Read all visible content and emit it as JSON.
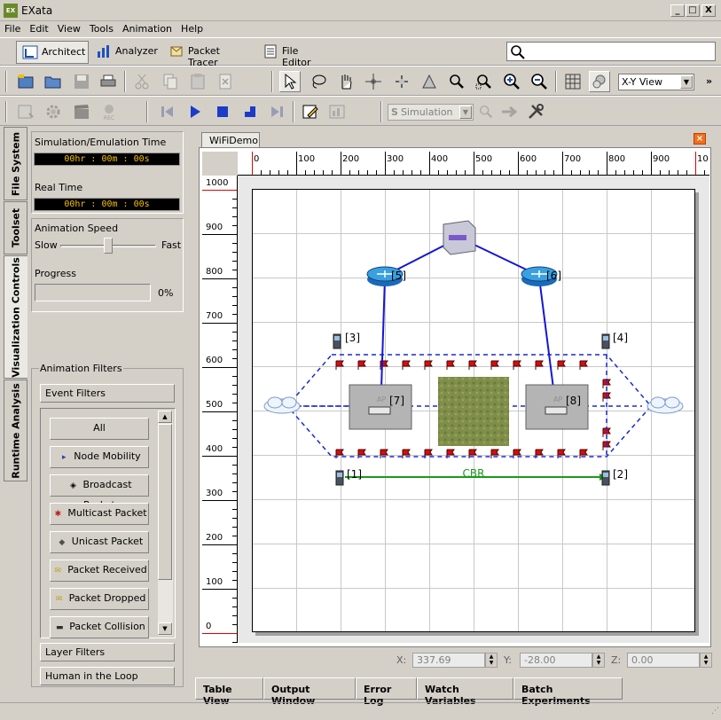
{
  "window": {
    "title": "EXata",
    "logo_text": "EX",
    "min": "_",
    "max": "□",
    "close": "X"
  },
  "menu": [
    "File",
    "Edit",
    "View",
    "Tools",
    "Animation",
    "Help"
  ],
  "app_tabs": [
    "Architect",
    "Analyzer",
    "Packet Tracer",
    "File Editor"
  ],
  "view_select": "X-Y View",
  "sim_select": "Simulation",
  "side_tabs": [
    "File System",
    "Toolset",
    "Visualization Controls",
    "Runtime Analysis"
  ],
  "panel": {
    "sim_time_label": "Simulation/Emulation Time",
    "sim_time": "00hr : 00m : 00s",
    "real_time_label": "Real Time",
    "real_time": "00hr : 00m : 00s",
    "anim_speed_label": "Animation Speed",
    "slow": "Slow",
    "fast": "Fast",
    "anim_speed_level": 0.5,
    "progress_label": "Progress",
    "progress_value": "0%",
    "filters_label": "Animation Filters",
    "event_filters": "Event Filters",
    "filters": [
      "All",
      "Node Mobility",
      "Broadcast Packet",
      "Multicast Packet",
      "Unicast Packet",
      "Packet Received",
      "Packet Dropped",
      "Packet Collision"
    ],
    "layer_filters": "Layer Filters",
    "hitl": "Human in the Loop"
  },
  "canvas": {
    "tab": "WiFiDemo",
    "x_ticks": [
      "0",
      "100",
      "200",
      "300",
      "400",
      "500",
      "600",
      "700",
      "800",
      "900",
      "10"
    ],
    "y_ticks": [
      "1000",
      "900",
      "800",
      "700",
      "600",
      "500",
      "400",
      "300",
      "200",
      "100",
      "0"
    ],
    "nodes": [
      {
        "id": "[1]",
        "type": "phone"
      },
      {
        "id": "[2]",
        "type": "phone"
      },
      {
        "id": "[3]",
        "type": "phone"
      },
      {
        "id": "[4]",
        "type": "phone"
      },
      {
        "id": "[5]",
        "type": "router"
      },
      {
        "id": "[6]",
        "type": "router"
      },
      {
        "id": "[7]",
        "type": "access-point"
      },
      {
        "id": "[8]",
        "type": "access-point"
      }
    ],
    "link_label": "CBR",
    "link_color": "#1a9a1a",
    "wired_color": "#1515d6",
    "ap_label": "AP"
  },
  "coords": {
    "x_label": "X:",
    "x": "337.69",
    "y_label": "Y:",
    "y": "-28.00",
    "z_label": "Z:",
    "z": "0.00"
  },
  "bottom_tabs": [
    "Table View",
    "Output Window",
    "Error Log",
    "Watch Variables",
    "Batch Experiments"
  ]
}
